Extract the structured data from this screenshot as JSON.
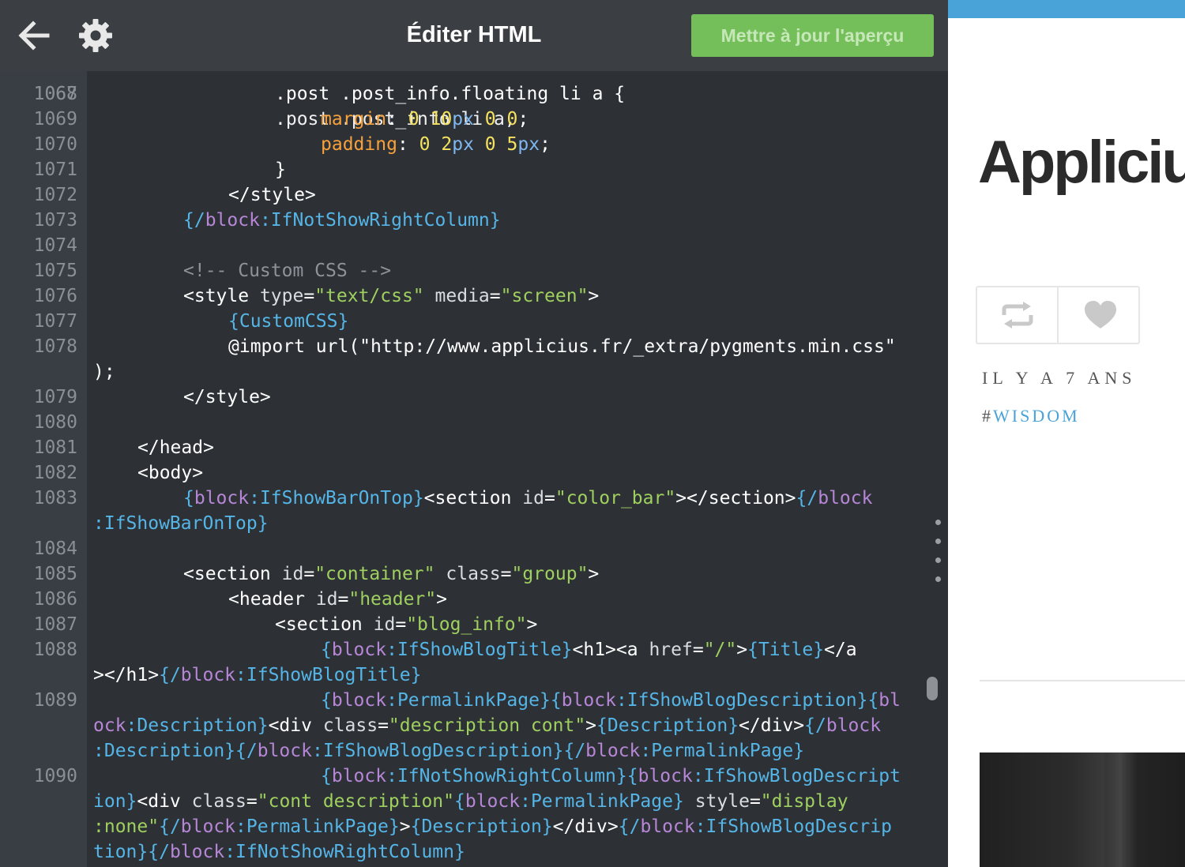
{
  "topbar": {
    "back_icon": "arrow-left-icon",
    "settings_icon": "gear-icon",
    "title": "Éditer HTML",
    "update_button": "Mettre à jour l'aperçu",
    "update_button_color": "#75bf5b"
  },
  "code": {
    "partial_top_line": {
      "num": "1067",
      "text": ".post .post_info li a,"
    },
    "lines": [
      {
        "num": "1068",
        "indent": 4,
        "cont": false,
        "tokens": [
          {
            "t": ".post .post_info.floating li a {",
            "c": "tag"
          }
        ]
      },
      {
        "num": "1069",
        "indent": 5,
        "cont": false,
        "tokens": [
          {
            "t": "margin",
            "c": "prop"
          },
          {
            "t": ": ",
            "c": "tag"
          },
          {
            "t": "0",
            "c": "num"
          },
          {
            "t": " ",
            "c": "tag"
          },
          {
            "t": "10",
            "c": "num"
          },
          {
            "t": "px",
            "c": "unit"
          },
          {
            "t": " ",
            "c": "tag"
          },
          {
            "t": "0",
            "c": "num"
          },
          {
            "t": " ",
            "c": "tag"
          },
          {
            "t": "0",
            "c": "num"
          },
          {
            "t": ";",
            "c": "tag"
          }
        ]
      },
      {
        "num": "1070",
        "indent": 5,
        "cont": false,
        "tokens": [
          {
            "t": "padding",
            "c": "prop"
          },
          {
            "t": ": ",
            "c": "tag"
          },
          {
            "t": "0",
            "c": "num"
          },
          {
            "t": " ",
            "c": "tag"
          },
          {
            "t": "2",
            "c": "num"
          },
          {
            "t": "px",
            "c": "unit"
          },
          {
            "t": " ",
            "c": "tag"
          },
          {
            "t": "0",
            "c": "num"
          },
          {
            "t": " ",
            "c": "tag"
          },
          {
            "t": "5",
            "c": "num"
          },
          {
            "t": "px",
            "c": "unit"
          },
          {
            "t": ";",
            "c": "tag"
          }
        ]
      },
      {
        "num": "1071",
        "indent": 4,
        "cont": false,
        "tokens": [
          {
            "t": "}",
            "c": "tag"
          }
        ]
      },
      {
        "num": "1072",
        "indent": 3,
        "cont": false,
        "tokens": [
          {
            "t": "</style>",
            "c": "tag"
          }
        ]
      },
      {
        "num": "1073",
        "indent": 2,
        "cont": false,
        "tokens": [
          {
            "t": "{/",
            "c": "blk"
          },
          {
            "t": "block",
            "c": "bn"
          },
          {
            "t": ":IfNotShowRightColumn}",
            "c": "blk"
          }
        ]
      },
      {
        "num": "1074",
        "indent": 0,
        "cont": false,
        "tokens": []
      },
      {
        "num": "1075",
        "indent": 2,
        "cont": false,
        "tokens": [
          {
            "t": "<!-- Custom CSS -->",
            "c": "com"
          }
        ]
      },
      {
        "num": "1076",
        "indent": 2,
        "cont": false,
        "tokens": [
          {
            "t": "<style ",
            "c": "tag"
          },
          {
            "t": "type",
            "c": "attr"
          },
          {
            "t": "=",
            "c": "tag"
          },
          {
            "t": "\"text/css\"",
            "c": "str"
          },
          {
            "t": " ",
            "c": "tag"
          },
          {
            "t": "media",
            "c": "attr"
          },
          {
            "t": "=",
            "c": "tag"
          },
          {
            "t": "\"screen\"",
            "c": "str"
          },
          {
            "t": ">",
            "c": "tag"
          }
        ]
      },
      {
        "num": "1077",
        "indent": 3,
        "cont": false,
        "tokens": [
          {
            "t": "{CustomCSS}",
            "c": "blk"
          }
        ]
      },
      {
        "num": "1078",
        "indent": 3,
        "cont": false,
        "tokens": [
          {
            "t": "@import url(\"http://www.applicius.fr/_extra/pygments.min.css\"",
            "c": "tag"
          }
        ]
      },
      {
        "num": "",
        "indent": 0,
        "cont": true,
        "tokens": [
          {
            "t": ");",
            "c": "tag"
          }
        ]
      },
      {
        "num": "1079",
        "indent": 2,
        "cont": false,
        "tokens": [
          {
            "t": "</style>",
            "c": "tag"
          }
        ]
      },
      {
        "num": "1080",
        "indent": 0,
        "cont": false,
        "tokens": []
      },
      {
        "num": "1081",
        "indent": 1,
        "cont": false,
        "tokens": [
          {
            "t": "</head>",
            "c": "tag"
          }
        ]
      },
      {
        "num": "1082",
        "indent": 1,
        "cont": false,
        "tokens": [
          {
            "t": "<body>",
            "c": "tag"
          }
        ]
      },
      {
        "num": "1083",
        "indent": 2,
        "cont": false,
        "tokens": [
          {
            "t": "{",
            "c": "blk"
          },
          {
            "t": "block",
            "c": "bn"
          },
          {
            "t": ":IfShowBarOnTop}",
            "c": "blk"
          },
          {
            "t": "<section ",
            "c": "tag"
          },
          {
            "t": "id",
            "c": "attr"
          },
          {
            "t": "=",
            "c": "tag"
          },
          {
            "t": "\"color_bar\"",
            "c": "str"
          },
          {
            "t": "></section>",
            "c": "tag"
          },
          {
            "t": "{/",
            "c": "blk"
          },
          {
            "t": "block",
            "c": "bn"
          }
        ]
      },
      {
        "num": "",
        "indent": 0,
        "cont": true,
        "tokens": [
          {
            "t": ":IfShowBarOnTop}",
            "c": "blk"
          }
        ]
      },
      {
        "num": "1084",
        "indent": 0,
        "cont": false,
        "tokens": []
      },
      {
        "num": "1085",
        "indent": 2,
        "cont": false,
        "tokens": [
          {
            "t": "<section ",
            "c": "tag"
          },
          {
            "t": "id",
            "c": "attr"
          },
          {
            "t": "=",
            "c": "tag"
          },
          {
            "t": "\"container\"",
            "c": "str"
          },
          {
            "t": " ",
            "c": "tag"
          },
          {
            "t": "class",
            "c": "attr"
          },
          {
            "t": "=",
            "c": "tag"
          },
          {
            "t": "\"group\"",
            "c": "str"
          },
          {
            "t": ">",
            "c": "tag"
          }
        ]
      },
      {
        "num": "1086",
        "indent": 3,
        "cont": false,
        "tokens": [
          {
            "t": "<header ",
            "c": "tag"
          },
          {
            "t": "id",
            "c": "attr"
          },
          {
            "t": "=",
            "c": "tag"
          },
          {
            "t": "\"header\"",
            "c": "str"
          },
          {
            "t": ">",
            "c": "tag"
          }
        ]
      },
      {
        "num": "1087",
        "indent": 4,
        "cont": false,
        "tokens": [
          {
            "t": "<section ",
            "c": "tag"
          },
          {
            "t": "id",
            "c": "attr"
          },
          {
            "t": "=",
            "c": "tag"
          },
          {
            "t": "\"blog_info\"",
            "c": "str"
          },
          {
            "t": ">",
            "c": "tag"
          }
        ]
      },
      {
        "num": "1088",
        "indent": 5,
        "cont": false,
        "tokens": [
          {
            "t": "{",
            "c": "blk"
          },
          {
            "t": "block",
            "c": "bn"
          },
          {
            "t": ":IfShowBlogTitle}",
            "c": "blk"
          },
          {
            "t": "<h1><a ",
            "c": "tag"
          },
          {
            "t": "href",
            "c": "attr"
          },
          {
            "t": "=",
            "c": "tag"
          },
          {
            "t": "\"/\"",
            "c": "str"
          },
          {
            "t": ">",
            "c": "tag"
          },
          {
            "t": "{Title}",
            "c": "blk"
          },
          {
            "t": "</a",
            "c": "tag"
          }
        ]
      },
      {
        "num": "",
        "indent": 0,
        "cont": true,
        "tokens": [
          {
            "t": "></h1>",
            "c": "tag"
          },
          {
            "t": "{/",
            "c": "blk"
          },
          {
            "t": "block",
            "c": "bn"
          },
          {
            "t": ":IfShowBlogTitle}",
            "c": "blk"
          }
        ]
      },
      {
        "num": "1089",
        "indent": 5,
        "cont": false,
        "tokens": [
          {
            "t": "{",
            "c": "blk"
          },
          {
            "t": "block",
            "c": "bn"
          },
          {
            "t": ":PermalinkPage}",
            "c": "blk"
          },
          {
            "t": "{",
            "c": "blk"
          },
          {
            "t": "block",
            "c": "bn"
          },
          {
            "t": ":IfShowBlogDescription}",
            "c": "blk"
          },
          {
            "t": "{",
            "c": "blk"
          },
          {
            "t": "bl",
            "c": "bn"
          }
        ]
      },
      {
        "num": "",
        "indent": 0,
        "cont": true,
        "tokens": [
          {
            "t": "ock",
            "c": "bn"
          },
          {
            "t": ":Description}",
            "c": "blk"
          },
          {
            "t": "<div ",
            "c": "tag"
          },
          {
            "t": "class",
            "c": "attr"
          },
          {
            "t": "=",
            "c": "tag"
          },
          {
            "t": "\"description cont\"",
            "c": "str"
          },
          {
            "t": ">",
            "c": "tag"
          },
          {
            "t": "{Description}",
            "c": "blk"
          },
          {
            "t": "</div>",
            "c": "tag"
          },
          {
            "t": "{/",
            "c": "blk"
          },
          {
            "t": "block",
            "c": "bn"
          }
        ]
      },
      {
        "num": "",
        "indent": 0,
        "cont": true,
        "tokens": [
          {
            "t": ":Description}",
            "c": "blk"
          },
          {
            "t": "{/",
            "c": "blk"
          },
          {
            "t": "block",
            "c": "bn"
          },
          {
            "t": ":IfShowBlogDescription}",
            "c": "blk"
          },
          {
            "t": "{/",
            "c": "blk"
          },
          {
            "t": "block",
            "c": "bn"
          },
          {
            "t": ":PermalinkPage}",
            "c": "blk"
          }
        ]
      },
      {
        "num": "1090",
        "indent": 5,
        "cont": false,
        "tokens": [
          {
            "t": "{",
            "c": "blk"
          },
          {
            "t": "block",
            "c": "bn"
          },
          {
            "t": ":IfNotShowRightColumn}",
            "c": "blk"
          },
          {
            "t": "{",
            "c": "blk"
          },
          {
            "t": "block",
            "c": "bn"
          },
          {
            "t": ":IfShowBlogDescript",
            "c": "blk"
          }
        ]
      },
      {
        "num": "",
        "indent": 0,
        "cont": true,
        "tokens": [
          {
            "t": "ion}",
            "c": "blk"
          },
          {
            "t": "<div ",
            "c": "tag"
          },
          {
            "t": "class",
            "c": "attr"
          },
          {
            "t": "=",
            "c": "tag"
          },
          {
            "t": "\"cont description\"",
            "c": "str"
          },
          {
            "t": "{",
            "c": "blk"
          },
          {
            "t": "block",
            "c": "bn"
          },
          {
            "t": ":PermalinkPage}",
            "c": "blk"
          },
          {
            "t": " ",
            "c": "tag"
          },
          {
            "t": "style",
            "c": "attr"
          },
          {
            "t": "=",
            "c": "tag"
          },
          {
            "t": "\"display",
            "c": "str"
          }
        ]
      },
      {
        "num": "",
        "indent": 0,
        "cont": true,
        "tokens": [
          {
            "t": ":none\"",
            "c": "str"
          },
          {
            "t": "{/",
            "c": "blk"
          },
          {
            "t": "block",
            "c": "bn"
          },
          {
            "t": ":PermalinkPage}",
            "c": "blk"
          },
          {
            "t": ">",
            "c": "tag"
          },
          {
            "t": "{Description}",
            "c": "blk"
          },
          {
            "t": "</div>",
            "c": "tag"
          },
          {
            "t": "{/",
            "c": "blk"
          },
          {
            "t": "block",
            "c": "bn"
          },
          {
            "t": ":IfShowBlogDescrip",
            "c": "blk"
          }
        ]
      },
      {
        "num": "",
        "indent": 0,
        "cont": true,
        "tokens": [
          {
            "t": "tion}",
            "c": "blk"
          },
          {
            "t": "{/",
            "c": "blk"
          },
          {
            "t": "block",
            "c": "bn"
          },
          {
            "t": ":IfNotShowRightColumn}",
            "c": "blk"
          }
        ]
      }
    ]
  },
  "preview": {
    "accent_color": "#4aa3d8",
    "blog_title": "Appliciu",
    "reblog_icon": "reblog-icon",
    "like_icon": "heart-icon",
    "post_date": "IL Y A 7 ANS",
    "tag_hash": "#",
    "tag_name": "WISDOM"
  }
}
